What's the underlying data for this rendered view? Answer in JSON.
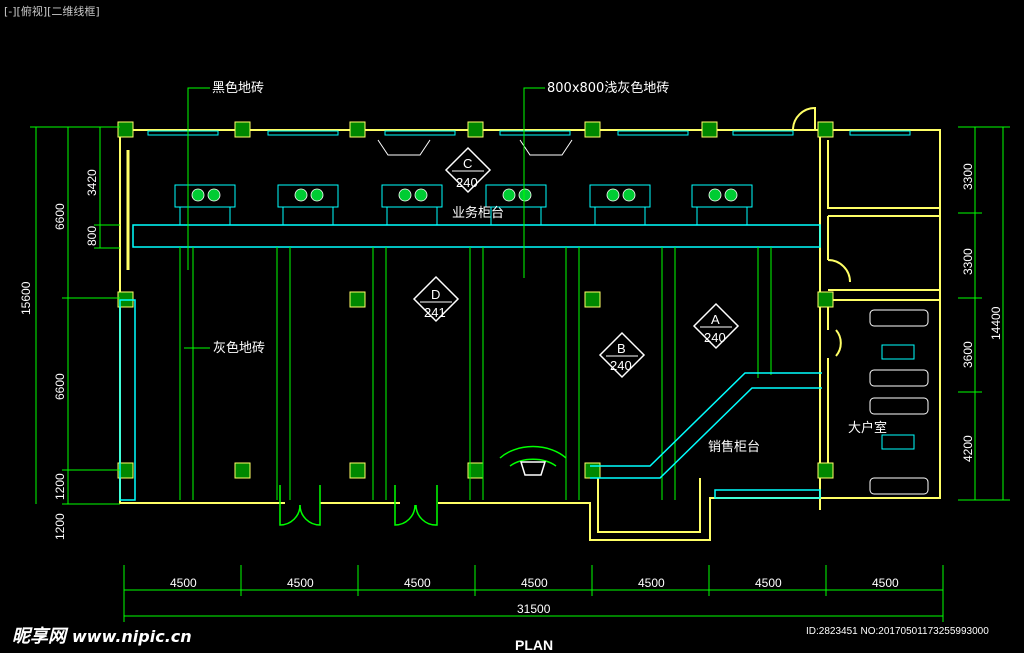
{
  "viewport": {
    "label": "[-][俯视][二维线框]"
  },
  "labels": {
    "black_tile": "黑色地砖",
    "light_gray_tile": "800x800浅灰色地砖",
    "service_counter": "业务柜台",
    "gray_tile": "灰色地砖",
    "sales_counter": "销售柜台",
    "vip_room": "大户室"
  },
  "elevation_tags": [
    {
      "letter": "C",
      "number": "240"
    },
    {
      "letter": "D",
      "number": "241"
    },
    {
      "letter": "B",
      "number": "240"
    },
    {
      "letter": "A",
      "number": "240"
    }
  ],
  "dimensions": {
    "bottom_segments": [
      "4500",
      "4500",
      "4500",
      "4500",
      "4500",
      "4500",
      "4500"
    ],
    "bottom_total": "31500",
    "left_outer_total": "15600",
    "left_segments": [
      "6600",
      "6600",
      "1200",
      "1200"
    ],
    "left_inner_segments": [
      "3420",
      "800"
    ],
    "right_segments": [
      "3300",
      "3300",
      "3600",
      "4200"
    ],
    "right_total": "14400"
  },
  "footer": {
    "plan_label": "PLAN",
    "watermark_brand": "昵享网",
    "watermark_url": "www.nipic.cn",
    "image_id": "ID:2823451 NO:20170501173255993000"
  },
  "colors": {
    "background": "#000000",
    "wall": "#ffff66",
    "partition": "#00ff00",
    "cyan": "#00ffff",
    "dimension": "#00ff00",
    "text": "#ffffff"
  }
}
